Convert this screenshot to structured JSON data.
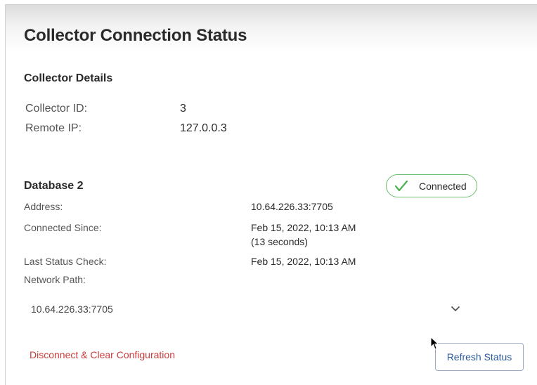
{
  "header": {
    "title": "Collector Connection Status"
  },
  "collector_details": {
    "section_title": "Collector Details",
    "rows": [
      {
        "label": "Collector ID:",
        "value": "3"
      },
      {
        "label": "Remote IP:",
        "value": "127.0.0.3"
      }
    ]
  },
  "database": {
    "title": "Database 2",
    "status": {
      "text": "Connected",
      "color": "#6cbf6c"
    },
    "rows": [
      {
        "label": "Address:",
        "value": "10.64.226.33:7705"
      },
      {
        "label": "Connected Since:",
        "value": "Feb 15, 2022, 10:13 AM",
        "value2": "(13 seconds)"
      },
      {
        "label": "Last Status Check:",
        "value": "Feb 15, 2022, 10:13 AM"
      },
      {
        "label": "Network Path:"
      }
    ],
    "network_path": {
      "selected": "10.64.226.33:7705",
      "icon": "chevron-down-icon"
    }
  },
  "actions": {
    "disconnect_label": "Disconnect & Clear Configuration",
    "disconnect_color": "#cc3b3b",
    "refresh_label": "Refresh Status"
  }
}
